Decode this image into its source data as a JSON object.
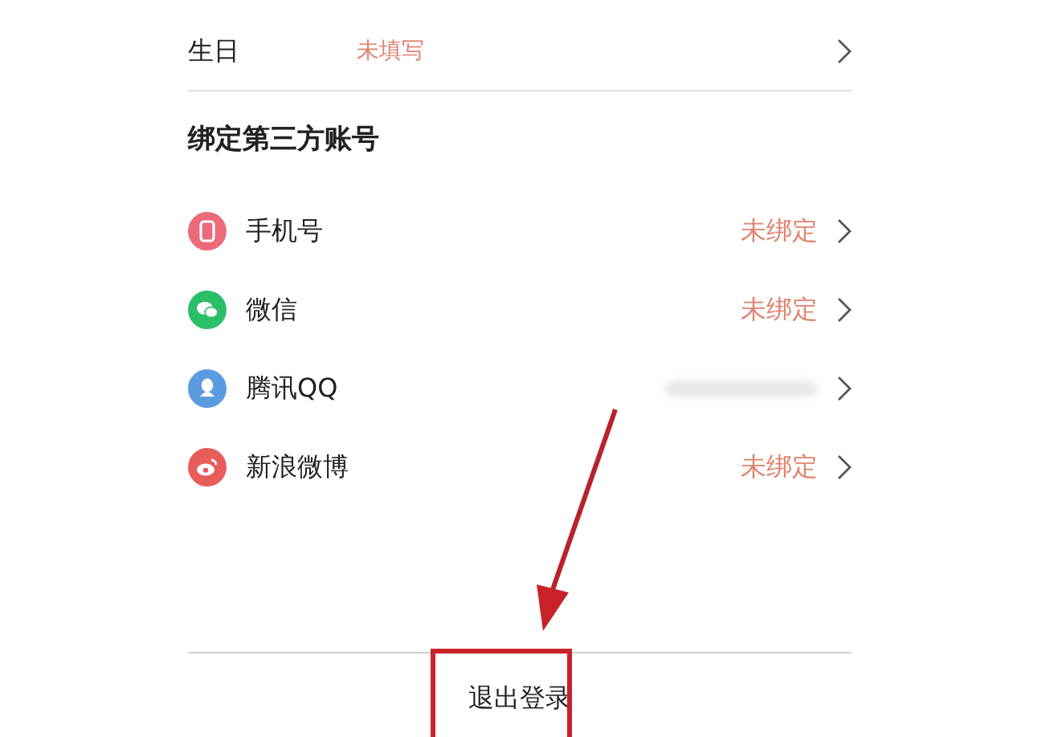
{
  "profile_row": {
    "label": "生日",
    "value": "未填写"
  },
  "section_title": "绑定第三方账号",
  "accounts": [
    {
      "kind": "phone",
      "name": "手机号",
      "status": "未绑定"
    },
    {
      "kind": "wechat",
      "name": "微信",
      "status": "未绑定"
    },
    {
      "kind": "qq",
      "name": "腾讯QQ",
      "blurred": true
    },
    {
      "kind": "weibo",
      "name": "新浪微博",
      "status": "未绑定"
    }
  ],
  "logout_button": "退出登录"
}
